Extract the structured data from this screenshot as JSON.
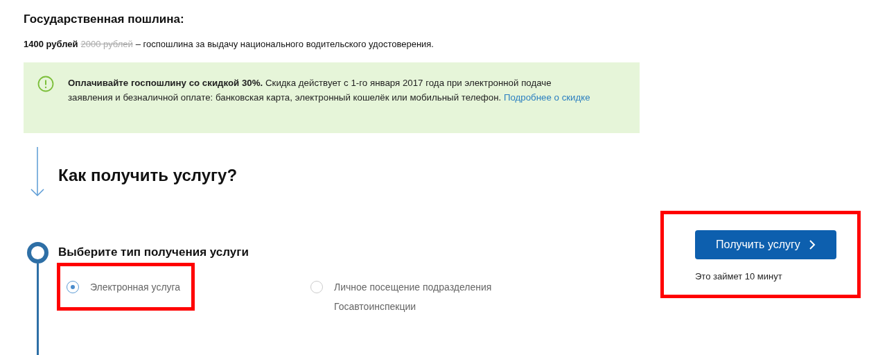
{
  "fee": {
    "title": "Государственная пошлина:",
    "price": "1400 рублей",
    "old_price": "2000 рублей",
    "description": "– госпошлина за выдачу национального водительского удостоверения."
  },
  "notice": {
    "text": "**Оплачивайте госпошлину со скидкой 30%.** Скидка действует с 1-го января 2017 года при электронной подаче заявления и безналичной оплате: банковская карта, электронный кошелёк или мобильный телефон.",
    "link": "Подробнее о скидке"
  },
  "how": {
    "title": "Как получить услугу?"
  },
  "step": {
    "title": "Выберите тип получения услуги",
    "options": [
      {
        "label": "Электронная услуга",
        "selected": true,
        "highlighted": true
      },
      {
        "label": "Личное посещение подразделения Госавтоинспекции",
        "selected": false,
        "highlighted": false
      }
    ]
  },
  "action": {
    "button": "Получить услугу",
    "note": "Это займет 10 минут",
    "highlighted": true
  }
}
